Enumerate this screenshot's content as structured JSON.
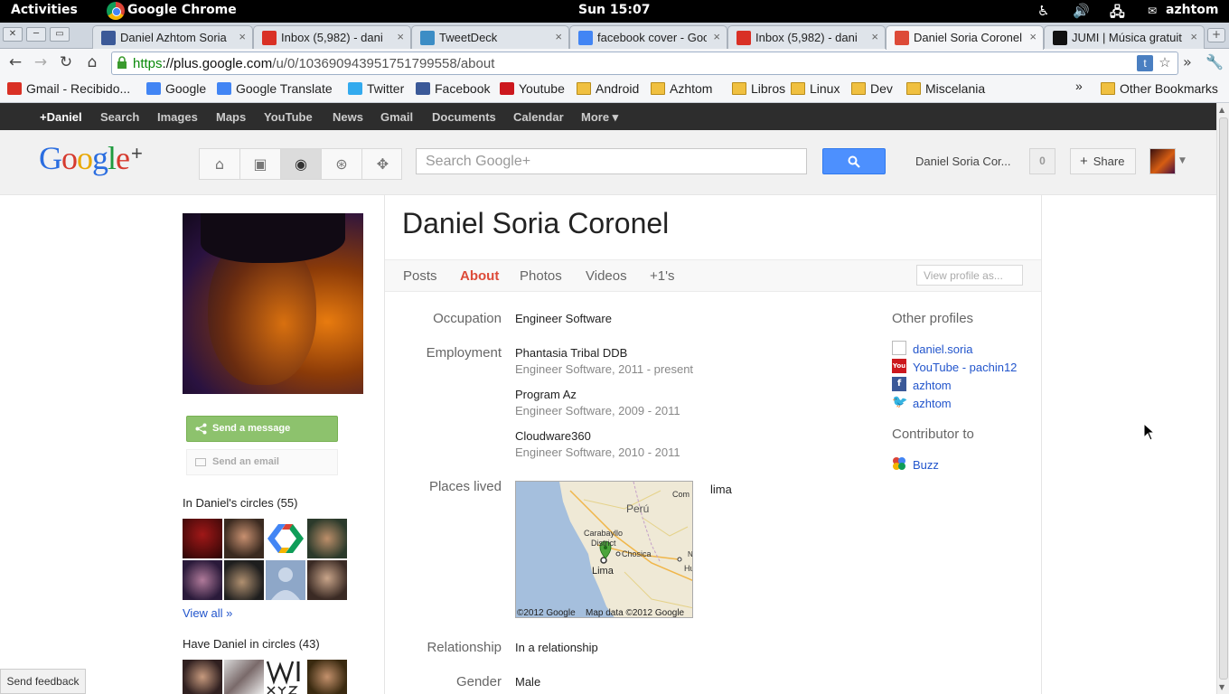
{
  "topbar": {
    "activities": "Activities",
    "app": "Google Chrome",
    "clock": "Sun 15:07",
    "user": "azhtom"
  },
  "tabs": [
    {
      "title": "Daniel Azhtom Soria",
      "icon": "facebook-icon",
      "color": "#3b5998"
    },
    {
      "title": "Inbox (5,982) - dani",
      "icon": "gmail-icon",
      "color": "#d93025"
    },
    {
      "title": "TweetDeck",
      "icon": "tweetdeck-icon",
      "color": "#3c8dc5"
    },
    {
      "title": "facebook cover - Goo",
      "icon": "google-icon",
      "color": "#4285f4"
    },
    {
      "title": "Inbox (5,982) - dani",
      "icon": "gmail-icon",
      "color": "#d93025"
    },
    {
      "title": "Daniel Soria Coronel",
      "icon": "googleplus-icon",
      "color": "#dd4b39"
    },
    {
      "title": "JUMI | Música gratuit",
      "icon": "jumi-icon",
      "color": "#111111"
    }
  ],
  "address": {
    "scheme": "https",
    "host": "://plus.google.com",
    "path": "/u/0/103690943951751799558/about"
  },
  "bookmarks": [
    {
      "label": "Gmail - Recibido...",
      "icon": "gmail-icon"
    },
    {
      "label": "Google",
      "icon": "google-icon"
    },
    {
      "label": "Google Translate",
      "icon": "translate-icon"
    },
    {
      "label": "Twitter",
      "icon": "twitter-icon"
    },
    {
      "label": "Facebook",
      "icon": "facebook-icon"
    },
    {
      "label": "Youtube",
      "icon": "youtube-icon"
    },
    {
      "label": "Android",
      "icon": "folder-icon"
    },
    {
      "label": "Azhtom",
      "icon": "folder-icon"
    },
    {
      "label": "Libros",
      "icon": "folder-icon"
    },
    {
      "label": "Linux",
      "icon": "folder-icon"
    },
    {
      "label": "Dev",
      "icon": "folder-icon"
    },
    {
      "label": "Miscelania",
      "icon": "folder-icon"
    }
  ],
  "other_bookmarks": "Other Bookmarks",
  "gbar": [
    "+Daniel",
    "Search",
    "Images",
    "Maps",
    "YouTube",
    "News",
    "Gmail",
    "Documents",
    "Calendar",
    "More ▾"
  ],
  "gplus": {
    "logo": "Google",
    "logo_plus": "+",
    "search_placeholder": "Search Google+",
    "user": "Daniel Soria Cor...",
    "notifications": "0",
    "share": "Share"
  },
  "profile": {
    "name": "Daniel Soria Coronel",
    "tabs": [
      "Posts",
      "About",
      "Photos",
      "Videos",
      "+1's"
    ],
    "active_tab": "About",
    "view_as": "View profile as...",
    "send_message": "Send a message",
    "send_email": "Send an email",
    "in_circles": "In Daniel's circles (55)",
    "view_all": "View all »",
    "have_in_circles": "Have Daniel in circles (43)"
  },
  "about": {
    "occupation_label": "Occupation",
    "occupation": "Engineer Software",
    "employment_label": "Employment",
    "employment": [
      {
        "company": "Phantasia Tribal DDB",
        "detail": "Engineer Software, 2011 - present"
      },
      {
        "company": "Program Az",
        "detail": "Engineer Software, 2009 - 2011"
      },
      {
        "company": "Cloudware360",
        "detail": "Engineer Software, 2010 - 2011"
      }
    ],
    "places_label": "Places lived",
    "place": "lima",
    "map": {
      "country": "Perú",
      "labels": [
        "Carabayllo",
        "District",
        "Chosica",
        "Lima",
        "Com",
        "Hu",
        "N"
      ],
      "copyright": "©2012 Google",
      "mapdata": "Map data ©2012 Google"
    },
    "relationship_label": "Relationship",
    "relationship": "In a relationship",
    "gender_label": "Gender",
    "gender": "Male"
  },
  "sidebar": {
    "other_profiles": "Other profiles",
    "profiles": [
      {
        "label": "daniel.soria",
        "icon": "page-icon"
      },
      {
        "label": "YouTube - pachin12",
        "icon": "youtube-icon"
      },
      {
        "label": "azhtom",
        "icon": "facebook-icon"
      },
      {
        "label": "azhtom",
        "icon": "twitter-icon"
      }
    ],
    "contributor_to": "Contributor to",
    "contributions": [
      {
        "label": "Buzz",
        "icon": "buzz-icon"
      }
    ]
  },
  "feedback": "Send feedback"
}
